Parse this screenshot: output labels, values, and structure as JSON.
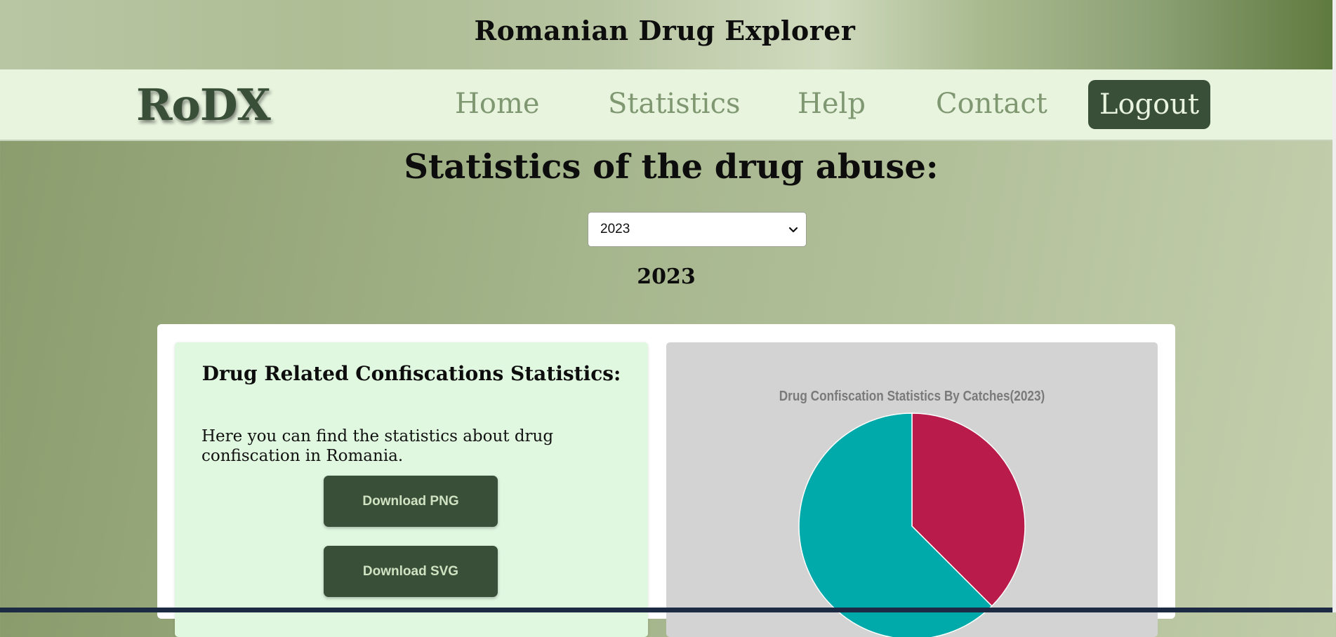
{
  "banner": {
    "title": "Romanian Drug Explorer"
  },
  "nav": {
    "logo": "RoDX",
    "links": [
      {
        "label": "Home"
      },
      {
        "label": "Statistics"
      },
      {
        "label": "Help"
      },
      {
        "label": "Contact"
      }
    ],
    "logout_label": "Logout"
  },
  "main": {
    "title": "Statistics of the drug abuse:",
    "year_select": {
      "selected": "2023"
    },
    "year_heading": "2023"
  },
  "info": {
    "heading": "Drug Related Confiscations Statistics:",
    "description": "Here you can find the statistics about drug confiscation in Romania.",
    "download_png": "Download PNG",
    "download_svg": "Download SVG"
  },
  "chart_data": {
    "type": "pie",
    "title": "Drug Confiscation Statistics By Catches(2023)",
    "slices": [
      {
        "value": 0.375,
        "color": "#b91b4b"
      },
      {
        "value": 0.625,
        "color": "#00aaaa"
      }
    ]
  }
}
